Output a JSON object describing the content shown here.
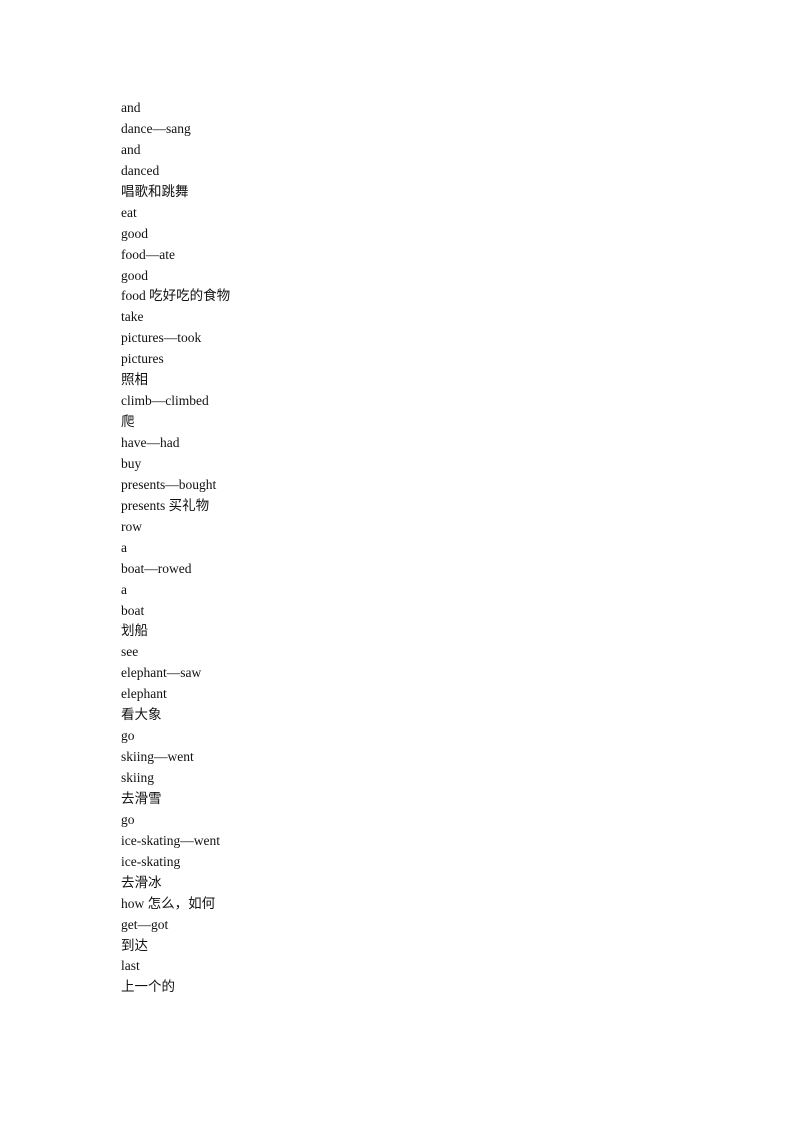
{
  "document": {
    "lines": [
      "and",
      "dance—sang",
      "and",
      "danced",
      "唱歌和跳舞",
      "eat",
      "good",
      "food—ate",
      "good",
      "food 吃好吃的食物",
      "take",
      "pictures—took",
      "pictures",
      "照相",
      "climb—climbed",
      "爬",
      "have—had",
      "buy",
      "presents—bought",
      "presents 买礼物",
      "row",
      "a",
      "boat—rowed",
      "a",
      "boat",
      "划船",
      "see",
      "elephant—saw",
      "elephant",
      "看大象",
      "go",
      "skiing—went",
      "skiing",
      "去滑雪",
      "go",
      "ice-skating—went",
      "ice-skating",
      "去滑冰",
      "how 怎么，如何",
      "get—got",
      "到达",
      "last",
      "上一个的"
    ]
  }
}
